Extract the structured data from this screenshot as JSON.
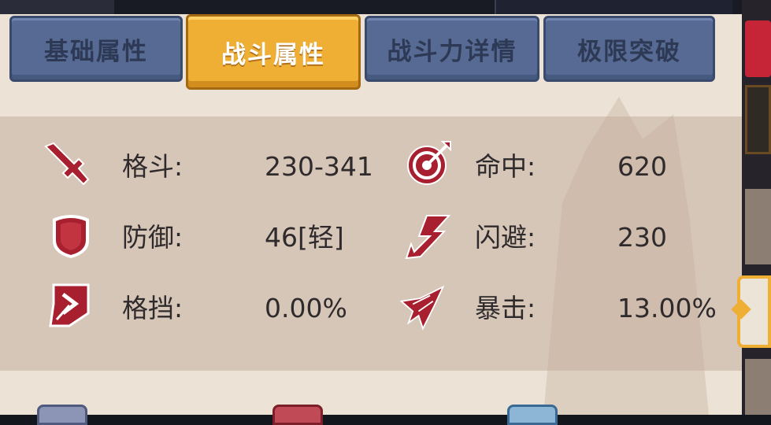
{
  "tabs": [
    {
      "label": "基础属性",
      "active": false
    },
    {
      "label": "战斗属性",
      "active": true
    },
    {
      "label": "战斗力详情",
      "active": false
    },
    {
      "label": "极限突破",
      "active": false
    }
  ],
  "stats": {
    "left": [
      {
        "icon": "sword-icon",
        "label": "格斗:",
        "value": "230-341"
      },
      {
        "icon": "shield-icon",
        "label": "防御:",
        "value": "46[轻]"
      },
      {
        "icon": "parry-icon",
        "label": "格挡:",
        "value": "0.00%"
      }
    ],
    "right": [
      {
        "icon": "target-icon",
        "label": "命中:",
        "value": "620"
      },
      {
        "icon": "dodge-arrow-icon",
        "label": "闪避:",
        "value": "230"
      },
      {
        "icon": "critical-strike-icon",
        "label": "暴击:",
        "value": "13.00%"
      }
    ]
  },
  "colors": {
    "active_tab": "#efae34",
    "inactive_tab": "#566a93",
    "icon_red": "#a8202f",
    "panel_bg": "#ece3d6",
    "stat_bg": "#d6c6b8"
  }
}
